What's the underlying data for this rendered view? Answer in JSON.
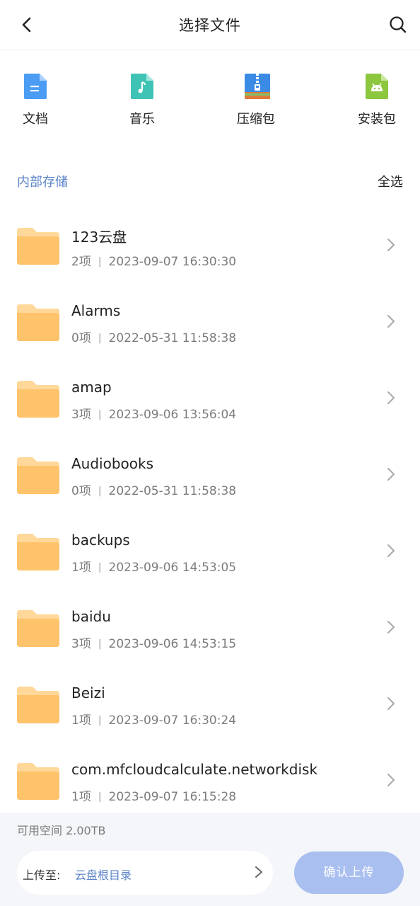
{
  "header": {
    "title": "选择文件",
    "back_icon": "chevron-left-icon",
    "search_icon": "search-icon"
  },
  "categories": [
    {
      "label": "文档",
      "icon": "document-icon",
      "color": "#4b9cf2"
    },
    {
      "label": "音乐",
      "icon": "music-icon",
      "color": "#3fc3b4"
    },
    {
      "label": "压缩包",
      "icon": "archive-icon",
      "color": "#3b8be6"
    },
    {
      "label": "安装包",
      "icon": "android-icon",
      "color": "#8dc63f"
    }
  ],
  "section": {
    "title": "内部存储",
    "select_all": "全选"
  },
  "folders": [
    {
      "name": "123云盘",
      "count": "2项",
      "date": "2023-09-07 16:30:30"
    },
    {
      "name": "Alarms",
      "count": "0项",
      "date": "2022-05-31 11:58:38"
    },
    {
      "name": "amap",
      "count": "3项",
      "date": "2023-09-06 13:56:04"
    },
    {
      "name": "Audiobooks",
      "count": "0项",
      "date": "2022-05-31 11:58:38"
    },
    {
      "name": "backups",
      "count": "1项",
      "date": "2023-09-06 14:53:05"
    },
    {
      "name": "baidu",
      "count": "3项",
      "date": "2023-09-06 14:53:15"
    },
    {
      "name": "Beizi",
      "count": "1项",
      "date": "2023-09-07 16:30:24"
    },
    {
      "name": "com.mfcloudcalculate.networkdisk",
      "count": "1项",
      "date": "2023-09-07 16:15:28"
    }
  ],
  "separator": "|",
  "bottom": {
    "available_space": "可用空间 2.00TB",
    "upload_label": "上传至:",
    "upload_dest": "云盘根目录",
    "confirm_label": "确认上传"
  },
  "colors": {
    "accent": "#5b84c8",
    "folder": "#ffc36b",
    "confirm_disabled": "#a9bff0"
  }
}
